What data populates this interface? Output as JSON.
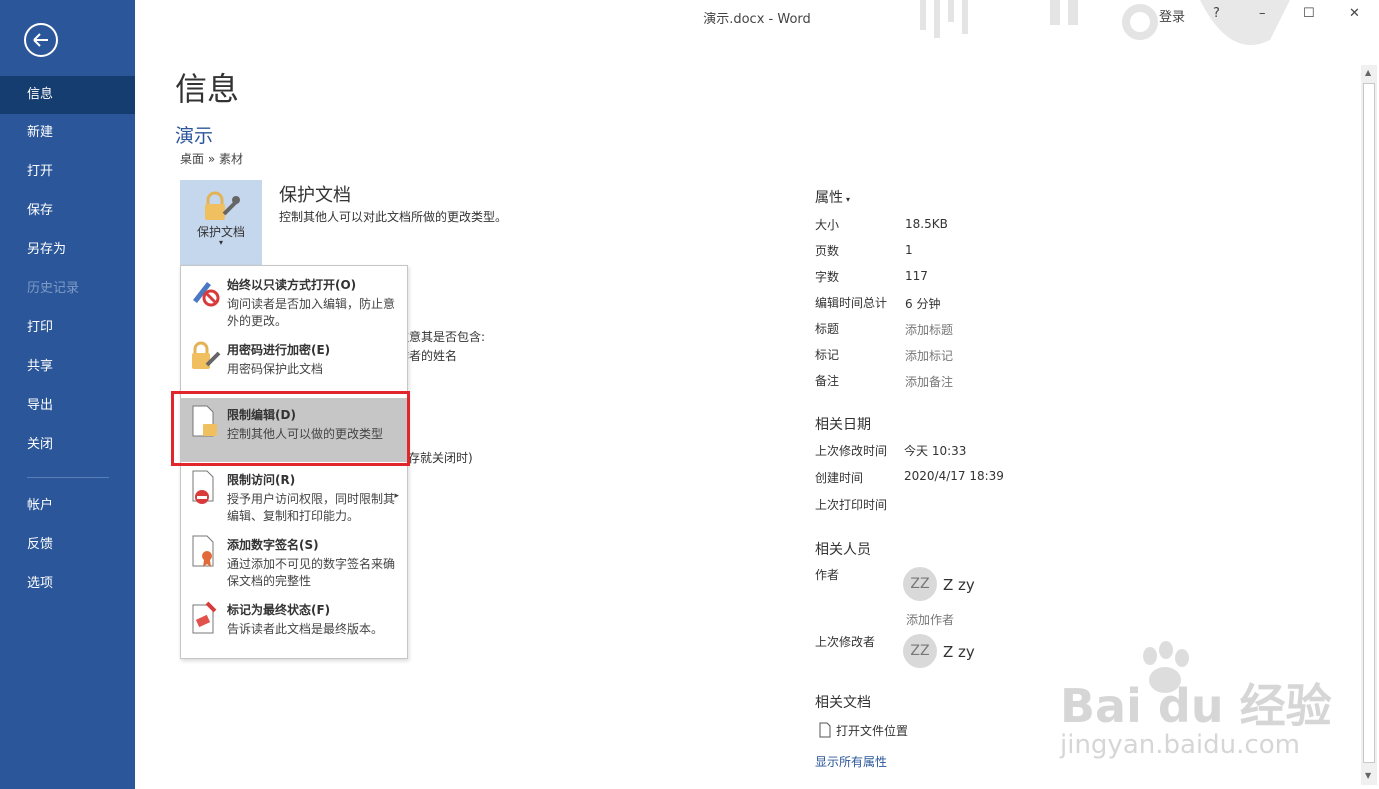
{
  "window": {
    "title": "演示.docx  -  Word",
    "signin": "登录",
    "help": "?",
    "minimize": "–",
    "maximize": "☐",
    "close": "✕"
  },
  "sidebar": {
    "items": [
      {
        "label": "信息",
        "active": true
      },
      {
        "label": "新建"
      },
      {
        "label": "打开"
      },
      {
        "label": "保存"
      },
      {
        "label": "另存为"
      },
      {
        "label": "历史记录",
        "disabled": true
      },
      {
        "label": "打印"
      },
      {
        "label": "共享"
      },
      {
        "label": "导出"
      },
      {
        "label": "关闭"
      },
      {
        "label": "帐户"
      },
      {
        "label": "反馈"
      },
      {
        "label": "选项"
      }
    ]
  },
  "main": {
    "title": "信息",
    "doc_name": "演示",
    "path": "桌面 » 素材",
    "protect_button": "保护文档",
    "protect_heading": "保护文档",
    "protect_desc": "控制其他人可以对此文档所做的更改类型。",
    "behind_texts": [
      "注意其是否包含:",
      "作者的姓名",
      "存就关闭时)"
    ]
  },
  "menu": {
    "items": [
      {
        "title": "始终以只读方式打开(O)",
        "desc": "询问读者是否加入编辑，防止意外的更改。"
      },
      {
        "title": "用密码进行加密(E)",
        "desc": "用密码保护此文档"
      },
      {
        "title": "限制编辑(D)",
        "desc": "控制其他人可以做的更改类型"
      },
      {
        "title": "限制访问(R)",
        "desc": "授予用户访问权限，同时限制其编辑、复制和打印能力。"
      },
      {
        "title": "添加数字签名(S)",
        "desc": "通过添加不可见的数字签名来确保文档的完整性"
      },
      {
        "title": "标记为最终状态(F)",
        "desc": "告诉读者此文档是最终版本。"
      }
    ],
    "submenu_arrow": "▸"
  },
  "properties": {
    "heading": "属性",
    "rows": [
      {
        "label": "大小",
        "value": "18.5KB"
      },
      {
        "label": "页数",
        "value": "1"
      },
      {
        "label": "字数",
        "value": "117"
      },
      {
        "label": "编辑时间总计",
        "value": "6 分钟"
      },
      {
        "label": "标题",
        "value": "添加标题"
      },
      {
        "label": "标记",
        "value": "添加标记"
      },
      {
        "label": "备注",
        "value": "添加备注"
      }
    ],
    "dates_heading": "相关日期",
    "dates": [
      {
        "label": "上次修改时间",
        "value": "今天 10:33"
      },
      {
        "label": "创建时间",
        "value": "2020/4/17 18:39"
      },
      {
        "label": "上次打印时间",
        "value": ""
      }
    ],
    "people_heading": "相关人员",
    "author_label": "作者",
    "author_initials": "ZZ",
    "author_name": "Z zy",
    "add_author": "添加作者",
    "modifier_label": "上次修改者",
    "modifier_initials": "ZZ",
    "modifier_name": "Z zy",
    "docs_heading": "相关文档",
    "open_location": "打开文件位置",
    "show_all": "显示所有属性"
  },
  "watermark": {
    "brand": "Bai du 经验",
    "url": "jingyan.baidu.com"
  },
  "colors": {
    "sidebar": "#2b579a",
    "sidebar_active": "#163d6f",
    "highlight": "#c6c6c6",
    "red_outline": "#e0262b",
    "link": "#2b579a"
  }
}
